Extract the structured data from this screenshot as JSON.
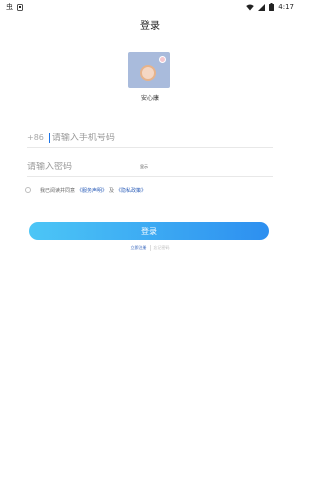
{
  "status_bar": {
    "app_icons": [
      "bug-icon",
      "notification-icon"
    ],
    "app_label": "虫",
    "time": "4:17",
    "icons": [
      "wifi-icon",
      "signal-icon",
      "battery-icon"
    ]
  },
  "header": {
    "title": "登录"
  },
  "app": {
    "name": "安心康",
    "logo_icon": "app-logo-icon"
  },
  "phone_field": {
    "prefix": "+86",
    "placeholder": "请输入手机号码",
    "value": ""
  },
  "password_field": {
    "placeholder": "请输入密码",
    "value": "",
    "show_label": "显示"
  },
  "agreement": {
    "checked": false,
    "text": "我已阅读并同意",
    "service_link": "《服务声明》",
    "and_text": "及",
    "privacy_link": "《隐私政策》"
  },
  "login_button": {
    "label": "登录"
  },
  "links": {
    "register": "立即注册",
    "forgot": "忘记密码"
  },
  "colors": {
    "accent": "#2d8ff0",
    "gradient_start": "#4cc6f6",
    "link": "#2b5db8"
  }
}
